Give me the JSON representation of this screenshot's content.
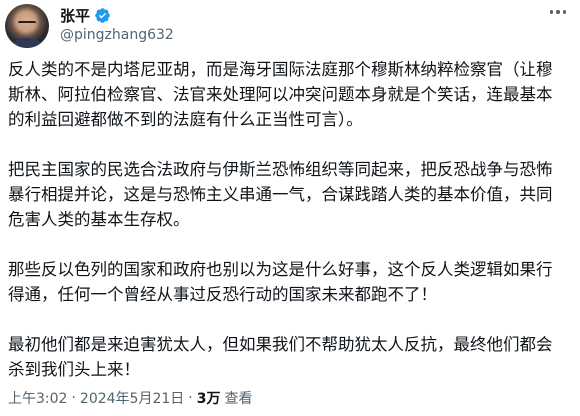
{
  "author": {
    "display_name": "张平",
    "handle": "@pingzhang632"
  },
  "icons": {
    "verified": "verified-badge-icon",
    "more": "more-horizontal-icon"
  },
  "colors": {
    "verified_badge": "#1d9bf0",
    "secondary_text": "#536471",
    "primary_text": "#0f1419"
  },
  "paragraphs": [
    "反人类的不是内塔尼亚胡，而是海牙国际法庭那个穆斯林纳粹检察官（让穆\n斯林、阿拉伯检察官、法官来处理阿以冲突问题本身就是个笑话，连最基本\n的利益回避都做不到的法庭有什么正当性可言）。",
    "把民主国家的民选合法政府与伊斯兰恐怖组织等同起来，把反恐战争与恐怖\n暴行相提并论，这是与恐怖主义串通一气，合谋践踏人类的基本价值，共同\n危害人类的基本生存权。",
    "那些反以色列的国家和政府也别以为这是什么好事，这个反人类逻辑如果行\n得通，任何一个曾经从事过反恐行动的国家未来都跑不了！",
    "最初他们都是来迫害犹太人，但如果我们不帮助犹太人反抗，最终他们都会\n杀到我们头上来！"
  ],
  "meta": {
    "time": "上午3:02",
    "separator": "·",
    "date": "2024年5月21日",
    "views_count": "3万",
    "views_label": "查看"
  }
}
